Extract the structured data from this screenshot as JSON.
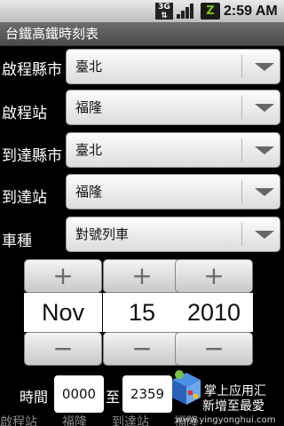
{
  "status_bar": {
    "network": "3G",
    "time": "2:59 AM"
  },
  "app": {
    "title": "台鐵高鐵時刻表"
  },
  "form": {
    "rows": [
      {
        "label": "啟程縣市",
        "value": "臺北"
      },
      {
        "label": "啟程站",
        "value": "福隆"
      },
      {
        "label": "到達縣市",
        "value": "臺北"
      },
      {
        "label": "到達站",
        "value": "福隆"
      },
      {
        "label": "車種",
        "value": "對號列車"
      }
    ]
  },
  "date_picker": {
    "month": "Nov",
    "day": "15",
    "year": "2010",
    "plus": "+",
    "minus": "−"
  },
  "time_range": {
    "label": "時間",
    "from": "0000",
    "to_label": "至",
    "to": "2359"
  },
  "watermark": {
    "line1": "掌上应用汇",
    "line2": "新增至最愛",
    "url": "www.yingyonghui.com"
  },
  "cutoff_text": "啟程站　　福隆　　到達站　　福隆"
}
